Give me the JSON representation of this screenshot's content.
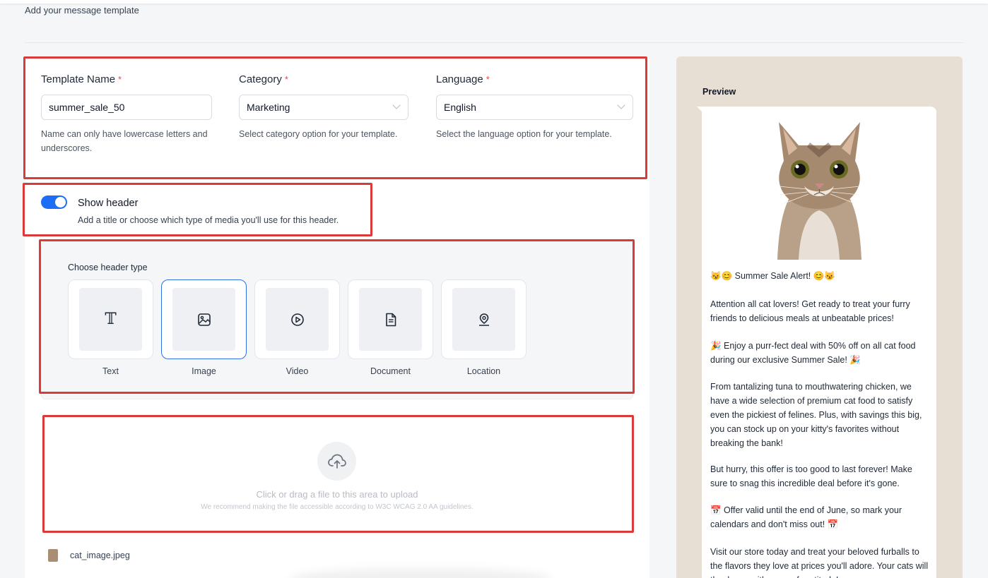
{
  "page": {
    "title": "Add your message template"
  },
  "form": {
    "template_name": {
      "label": "Template Name",
      "required": "*",
      "value": "summer_sale_50",
      "help": "Name can only have lowercase letters and underscores."
    },
    "category": {
      "label": "Category",
      "required": "*",
      "value": "Marketing",
      "help": "Select category option for your template."
    },
    "language": {
      "label": "Language",
      "required": "*",
      "value": "English",
      "help": "Select the language option for your template."
    }
  },
  "header_toggle": {
    "title": "Show header",
    "description": "Add a title or choose which type of media you'll use for this header.",
    "enabled": true
  },
  "header_type": {
    "label": "Choose header type",
    "selected": "Image",
    "options": [
      {
        "label": "Text",
        "icon": "text-icon"
      },
      {
        "label": "Image",
        "icon": "image-icon"
      },
      {
        "label": "Video",
        "icon": "play-icon"
      },
      {
        "label": "Document",
        "icon": "document-icon"
      },
      {
        "label": "Location",
        "icon": "location-pin-icon"
      }
    ]
  },
  "upload": {
    "main_text": "Click or drag a file to this area to upload",
    "sub_text": "We recommend making the file accessible according to W3C WCAG 2.0 AA guidelines."
  },
  "file": {
    "name": "cat_image.jpeg"
  },
  "preview": {
    "title": "Preview",
    "messages": [
      "😼😊 Summer Sale Alert! 😊😼",
      "Attention all cat lovers! Get ready to treat your furry friends to delicious meals at unbeatable prices!",
      "🎉 Enjoy a purr-fect deal with 50% off on all cat food during our exclusive Summer Sale! 🎉",
      "From tantalizing tuna to mouthwatering chicken, we have a wide selection of premium cat food to satisfy even the pickiest of felines. Plus, with savings this big, you can stock up on your kitty's favorites without breaking the bank!",
      "But hurry, this offer is too good to last forever! Make sure to snag this incredible deal before it's gone.",
      "📅 Offer valid until the end of June, so mark your calendars and don't miss out! 📅",
      "Visit our store today and treat your beloved furballs to the flavors they love at prices you'll adore. Your cats will thank you with purrs of gratitude!"
    ]
  },
  "colors": {
    "accent": "#1d6ef5",
    "highlight_box": "#d93a3a",
    "required": "#ef4444",
    "preview_bg": "#e7dfd4"
  }
}
